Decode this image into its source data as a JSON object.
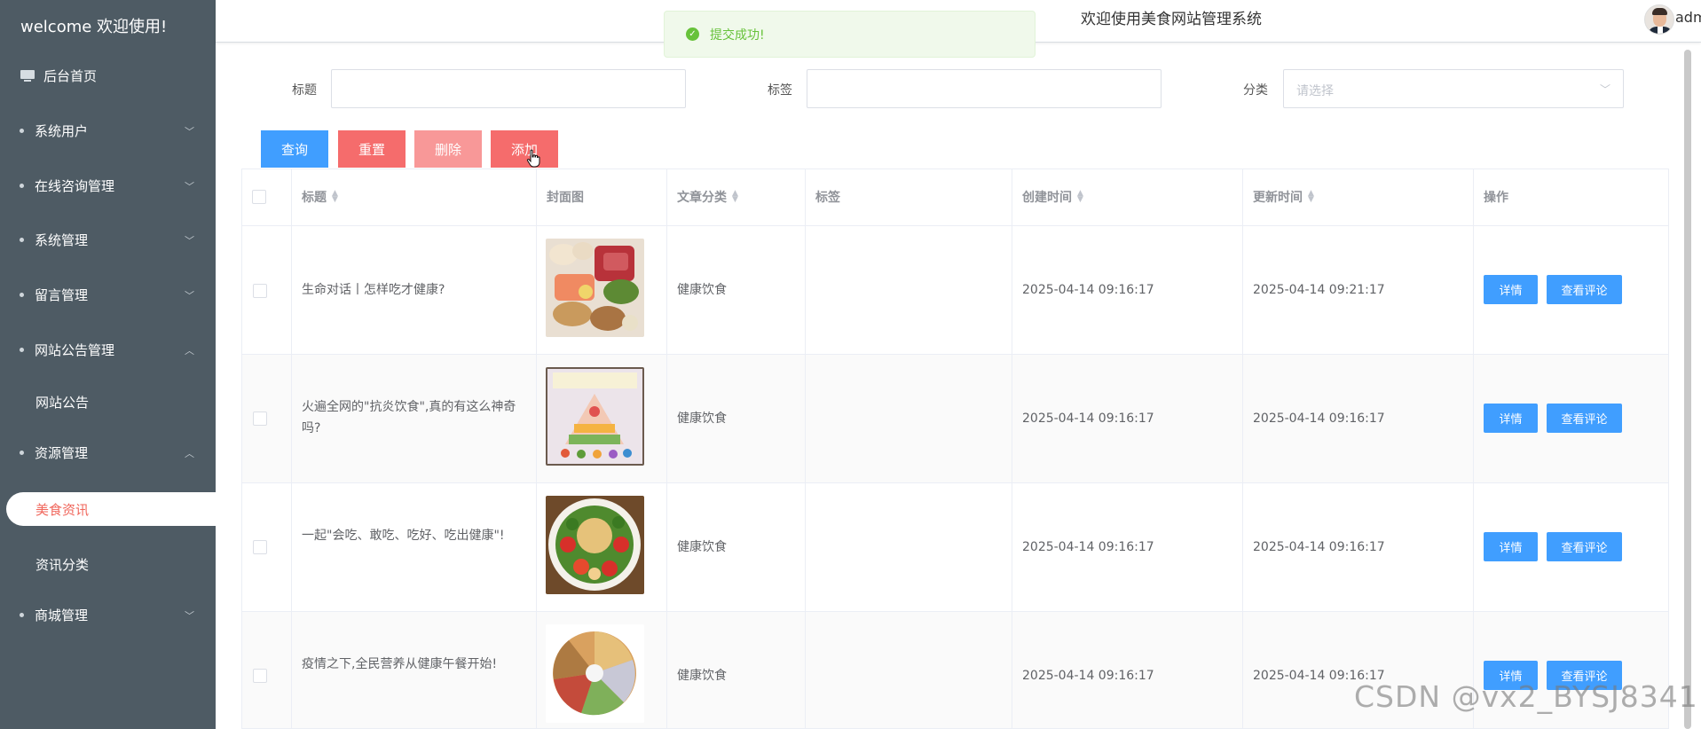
{
  "sidebar": {
    "welcome": "welcome 欢迎使用!",
    "home": "后台首页",
    "items": [
      {
        "label": "系统用户",
        "expanded": false
      },
      {
        "label": "在线咨询管理",
        "expanded": false
      },
      {
        "label": "系统管理",
        "expanded": false
      },
      {
        "label": "留言管理",
        "expanded": false
      },
      {
        "label": "网站公告管理",
        "expanded": true
      },
      {
        "label": "网站公告"
      },
      {
        "label": "资源管理",
        "expanded": true
      },
      {
        "label": "美食资讯",
        "active": true
      },
      {
        "label": "资讯分类"
      },
      {
        "label": "商城管理",
        "expanded": false
      }
    ]
  },
  "header": {
    "title": "欢迎使用美食网站管理系统",
    "user": "admin"
  },
  "toast": {
    "message": "提交成功!",
    "type": "success"
  },
  "filters": {
    "title_label": "标题",
    "title_value": "",
    "tag_label": "标签",
    "tag_value": "",
    "category_label": "分类",
    "category_placeholder": "请选择"
  },
  "buttons": {
    "search": "查询",
    "reset": "重置",
    "delete": "删除",
    "add": "添加"
  },
  "table": {
    "columns": [
      "标题",
      "封面图",
      "文章分类",
      "标签",
      "创建时间",
      "更新时间",
      "操作"
    ],
    "rows": [
      {
        "title": "生命对话丨怎样吃才健康?",
        "category": "健康饮食",
        "tag": "",
        "created": "2025-04-14 09:16:17",
        "updated": "2025-04-14 09:21:17"
      },
      {
        "title": "火遍全网的\"抗炎饮食\",真的有这么神奇吗?",
        "category": "健康饮食",
        "tag": "",
        "created": "2025-04-14 09:16:17",
        "updated": "2025-04-14 09:16:17"
      },
      {
        "title": "一起\"会吃、敢吃、吃好、吃出健康\"!",
        "category": "健康饮食",
        "tag": "",
        "created": "2025-04-14 09:16:17",
        "updated": "2025-04-14 09:16:17"
      },
      {
        "title": "疫情之下,全民营养从健康午餐开始!",
        "category": "健康饮食",
        "tag": "",
        "created": "2025-04-14 09:16:17",
        "updated": "2025-04-14 09:16:17"
      }
    ],
    "detail_label": "详情",
    "comments_label": "查看评论"
  },
  "watermark": "CSDN @vx2_BYSJ8341",
  "colors": {
    "sidebar": "#4e5b64",
    "active": "#f0665b",
    "primary": "#409eff",
    "danger": "#f56c6c",
    "success": "#67c23a"
  }
}
